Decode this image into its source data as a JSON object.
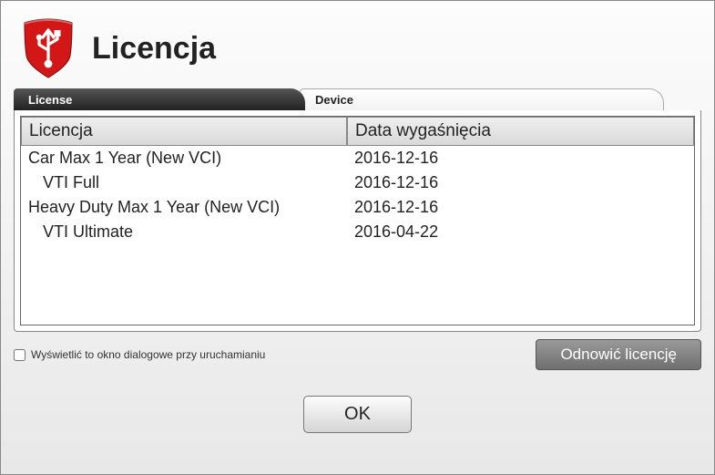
{
  "header": {
    "title": "Licencja"
  },
  "tabs": {
    "license": "License",
    "device": "Device"
  },
  "table": {
    "columns": {
      "license": "Licencja",
      "expiry": "Data wygaśnięcia"
    },
    "rows": [
      {
        "license": "Car Max 1 Year (New VCI)",
        "expiry": "2016-12-16",
        "indent": false
      },
      {
        "license": "VTI Full",
        "expiry": "2016-12-16",
        "indent": true
      },
      {
        "license": "Heavy Duty Max 1 Year (New VCI)",
        "expiry": "2016-12-16",
        "indent": false
      },
      {
        "license": "VTI Ultimate",
        "expiry": "2016-04-22",
        "indent": true
      }
    ]
  },
  "checkbox": {
    "label": "Wyświetlić to okno dialogowe przy uruchamianiu",
    "checked": false
  },
  "buttons": {
    "renew": "Odnowić licencję",
    "ok": "OK"
  }
}
